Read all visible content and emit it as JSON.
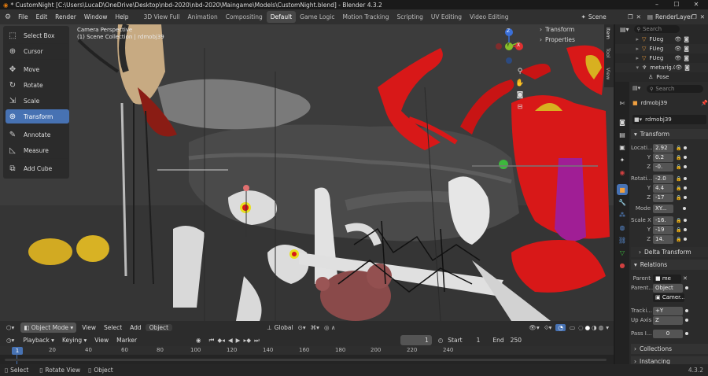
{
  "window": {
    "title": "* CustomNight [C:\\Users\\LucaD\\OneDrive\\Desktop\\nbd-2020\\nbd-2020\\Maingame\\Models\\CustomNight.blend] - Blender 4.3.2",
    "controls": [
      "–",
      "☐",
      "✕"
    ]
  },
  "menu": [
    "File",
    "Edit",
    "Render",
    "Window",
    "Help"
  ],
  "workspaces": [
    "3D View Full",
    "Animation",
    "Compositing",
    "Default",
    "Game Logic",
    "Motion Tracking",
    "Scripting",
    "UV Editing",
    "Video Editing"
  ],
  "active_workspace": "Default",
  "scene": {
    "label": "Scene",
    "view_layer": "RenderLayer"
  },
  "tools": [
    "Select Box",
    "Cursor",
    "Move",
    "Rotate",
    "Scale",
    "Transform",
    "Annotate",
    "Measure",
    "Add Cube"
  ],
  "tool_icons": [
    "select-box-icon",
    "cursor-icon",
    "move-icon",
    "rotate-icon",
    "scale-icon",
    "transform-icon",
    "annotate-icon",
    "measure-icon",
    "add-cube-icon"
  ],
  "active_tool": "Transform",
  "viewport": {
    "line1": "Camera Perspective",
    "line2": "(1) Scene Collection | rdmobj39"
  },
  "npanel": {
    "transform": "Transform",
    "properties": "Properties",
    "tabs": [
      "Item",
      "Tool",
      "View"
    ]
  },
  "gizmo": {
    "z": "Z",
    "y": "Y",
    "x": "X"
  },
  "header": {
    "mode": "Object Mode",
    "menus": [
      "View",
      "Select",
      "Add",
      "Object"
    ],
    "orientation": "Global"
  },
  "timeline": {
    "menus": [
      "Playback",
      "Keying",
      "View",
      "Marker"
    ],
    "current_frame": "1",
    "start_label": "Start",
    "start": "1",
    "end_label": "End",
    "end": "250",
    "ruler": [
      "1",
      "20",
      "40",
      "60",
      "80",
      "100",
      "120",
      "140",
      "160",
      "180",
      "200",
      "220",
      "240"
    ]
  },
  "status": {
    "select": "Select",
    "rotate": "Rotate View",
    "object": "Object",
    "version": "4.3.2"
  },
  "outliner": {
    "search": "Search",
    "items": [
      {
        "name": "FUeg"
      },
      {
        "name": "FUeg"
      },
      {
        "name": "FUeg"
      },
      {
        "name": "metarig.0"
      },
      {
        "name": "Pose"
      }
    ]
  },
  "properties": {
    "search": "Search",
    "object_name": "rdmobj39",
    "data_name": "rdmobj39",
    "transform": "Transform",
    "location_label": "Locati...",
    "rotation_label": "Rotati...",
    "scale_label": "Scale X",
    "location": [
      "2.92",
      "0.2",
      "-0."
    ],
    "rotation": [
      "-2.0",
      "4.4",
      "-17"
    ],
    "scale": [
      "-16.",
      "-19",
      "14."
    ],
    "axes": [
      "Y",
      "Z"
    ],
    "mode_label": "Mode",
    "mode_value": "XY...",
    "delta": "Delta Transform",
    "relations": "Relations",
    "parent_label": "Parent",
    "parent_value": "me",
    "parent_type_label": "Parent...",
    "parent_type_value": "Object",
    "camera_value": "Camer...",
    "tracking_label": "Tracki...",
    "tracking_value": "+Y",
    "upaxis_label": "Up Axis",
    "upaxis_value": "Z",
    "pass_label": "Pass I...",
    "pass_value": "0",
    "collections": "Collections",
    "instancing": "Instancing"
  },
  "colors": {
    "accent": "#4772b3",
    "active_tab": "#4772b3",
    "red_model": "#d81818",
    "yellow_model": "#d8b020",
    "pink_model": "#a02090"
  }
}
